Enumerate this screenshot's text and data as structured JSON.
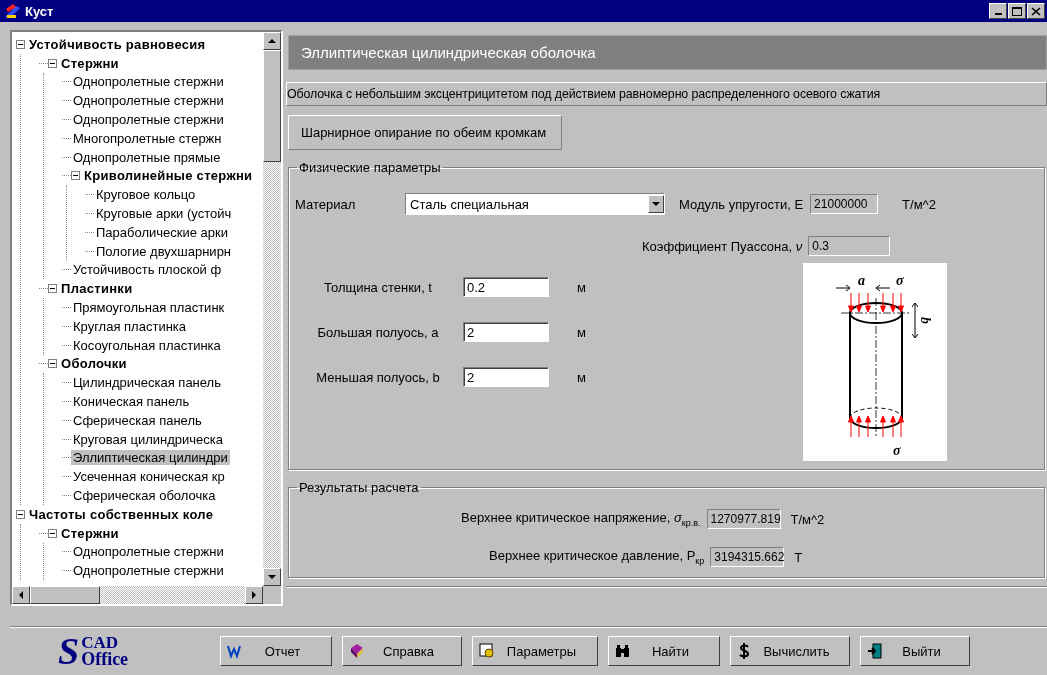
{
  "window": {
    "title": "Куст"
  },
  "tree": [
    {
      "label": "Устойчивость равновесия",
      "expanded": true,
      "selected": false,
      "children": [
        {
          "label": "Стержни",
          "expanded": true,
          "selected": false,
          "children": [
            {
              "label": "Однопролетные стержни",
              "selected": false
            },
            {
              "label": "Однопролетные стержни",
              "selected": false
            },
            {
              "label": "Однопролетные стержни",
              "selected": false
            },
            {
              "label": "Многопролетные стержн",
              "selected": false
            },
            {
              "label": "Однопролетные прямые",
              "selected": false
            },
            {
              "label": "Криволинейные стержни",
              "expanded": true,
              "selected": false,
              "children": [
                {
                  "label": "Круговое кольцо",
                  "selected": false
                },
                {
                  "label": "Круговые арки (устойч",
                  "selected": false
                },
                {
                  "label": "Параболические арки",
                  "selected": false
                },
                {
                  "label": "Пологие двухшарнирн",
                  "selected": false
                }
              ]
            },
            {
              "label": "Устойчивость плоской ф",
              "selected": false
            }
          ]
        },
        {
          "label": "Пластинки",
          "expanded": true,
          "selected": false,
          "children": [
            {
              "label": "Прямоугольная пластинк",
              "selected": false
            },
            {
              "label": "Круглая пластинка",
              "selected": false
            },
            {
              "label": "Косоугольная пластинка",
              "selected": false
            }
          ]
        },
        {
          "label": "Оболочки",
          "expanded": true,
          "selected": false,
          "children": [
            {
              "label": "Цилиндрическая панель",
              "selected": false
            },
            {
              "label": "Коническая панель",
              "selected": false
            },
            {
              "label": "Сферическая панель",
              "selected": false
            },
            {
              "label": "Круговая цилиндрическа",
              "selected": false
            },
            {
              "label": "Эллиптическая цилиндри",
              "selected": true
            },
            {
              "label": "Усеченная коническая кр",
              "selected": false
            },
            {
              "label": "Сферическая оболочка",
              "selected": false
            }
          ]
        }
      ]
    },
    {
      "label": "Частоты собственных коле",
      "expanded": true,
      "selected": false,
      "children": [
        {
          "label": "Стержни",
          "expanded": true,
          "selected": false,
          "children": [
            {
              "label": "Однопролетные стержни",
              "selected": false
            },
            {
              "label": "Однопролетные стержни",
              "selected": false
            }
          ]
        }
      ]
    }
  ],
  "panel": {
    "title": "Эллиптическая цилиндрическая оболочка",
    "description": "Оболочка с небольшим эксцентрицитетом под действием равномерно распределенного осевого сжатия",
    "support_tab": "Шарнирное опирание по обеим кромкам",
    "physical": {
      "legend": "Физические параметры",
      "material": {
        "label": "Материал",
        "value": "Сталь специальная"
      },
      "modulus": {
        "label": "Модуль упругости, E",
        "value": "21000000",
        "unit": "Т/м^2"
      },
      "poisson": {
        "label": "Коэффициент Пуассона, *ν*",
        "value": "0.3"
      },
      "inputs": [
        {
          "label": "Толщина стенки, t",
          "value": "0.2",
          "unit": "м"
        },
        {
          "label": "Большая полуось, a",
          "value": "2",
          "unit": "м"
        },
        {
          "label": "Меньшая полуось, b",
          "value": "2",
          "unit": "м"
        }
      ],
      "diagram": {
        "labels": [
          "a",
          "σ",
          "b",
          "σ"
        ]
      }
    },
    "results": {
      "legend": "Результаты расчета",
      "rows": [
        {
          "label": "Верхнее критическое напряжение, *σ*$_{кр.в.}$",
          "value": "1270977.819",
          "unit": "Т/м^2"
        },
        {
          "label": "Верхнее критическое давление, P$_{кр}$",
          "value": "3194315.662",
          "unit": "Т"
        }
      ]
    }
  },
  "logo": {
    "mark": "S",
    "top": "CAD",
    "bottom": "Office"
  },
  "buttons": [
    "Отчет",
    "Справка",
    "Параметры",
    "Найти",
    "Вычислить",
    "Выйти"
  ]
}
